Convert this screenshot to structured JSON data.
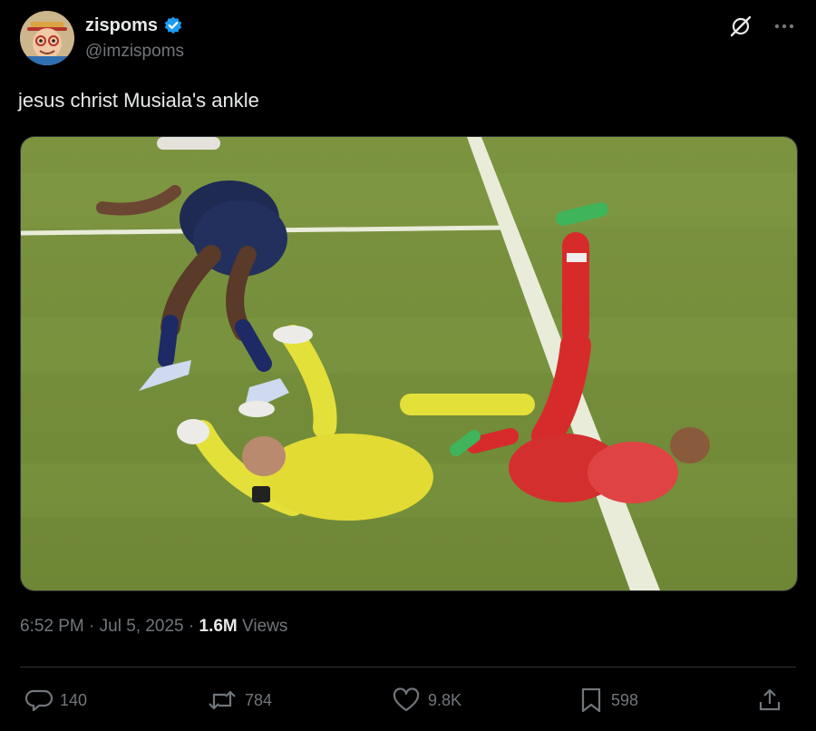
{
  "author": {
    "display_name": "zispoms",
    "handle": "@imzispoms",
    "verified_badge_icon": "verified-badge-icon",
    "avatar_icon": "cartoon-avatar"
  },
  "top_actions": {
    "grok_icon": "grok-icon",
    "more_icon": "more-icon"
  },
  "tweet": {
    "text": "jesus christ Musiala's ankle",
    "media_kind": "video-still"
  },
  "meta": {
    "time": "6:52 PM",
    "sep1": "·",
    "date": "Jul 5, 2025",
    "sep2": "·",
    "views_count": "1.6M",
    "views_label": "Views"
  },
  "actions": {
    "reply": {
      "icon": "reply-icon",
      "count": "140"
    },
    "retweet": {
      "icon": "retweet-icon",
      "count": "784"
    },
    "like": {
      "icon": "heart-icon",
      "count": "9.8K"
    },
    "bookmark": {
      "icon": "bookmark-icon",
      "count": "598"
    },
    "share": {
      "icon": "share-icon"
    }
  },
  "colors": {
    "background": "#000000",
    "text": "#e7e9ea",
    "muted": "#71767b",
    "verified": "#1d9bf0",
    "divider": "#2f3336"
  }
}
